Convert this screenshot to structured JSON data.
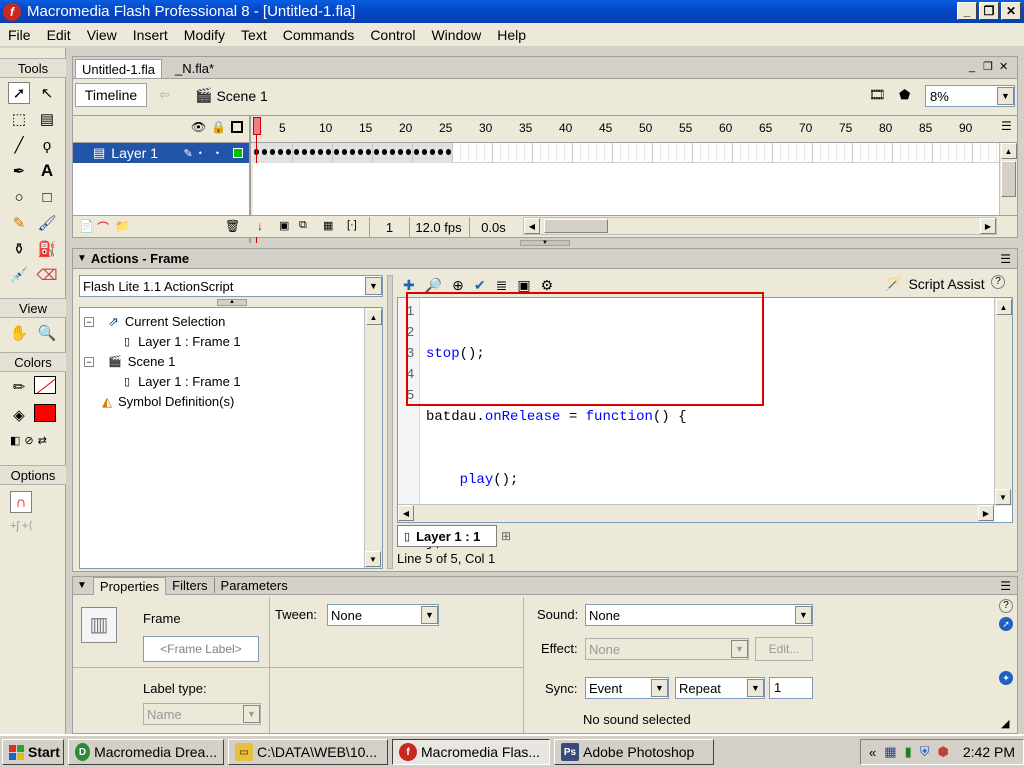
{
  "window": {
    "title": "Macromedia Flash Professional 8 - [Untitled-1.fla]",
    "app_icon": "flash-icon"
  },
  "menu": [
    "File",
    "Edit",
    "View",
    "Insert",
    "Modify",
    "Text",
    "Commands",
    "Control",
    "Window",
    "Help"
  ],
  "tools": {
    "title": "Tools",
    "view_label": "View",
    "colors_label": "Colors",
    "options_label": "Options",
    "stroke_color": "#000000",
    "fill_color": "#ff0000"
  },
  "documents": {
    "tabs": [
      "Untitled-1.fla",
      "_N.fla*"
    ],
    "timeline_button": "Timeline",
    "scene": "Scene 1",
    "zoom": "8%"
  },
  "timeline": {
    "frame_numbers": [
      "1",
      "5",
      "10",
      "15",
      "20",
      "25",
      "30",
      "35",
      "40",
      "45",
      "50",
      "55",
      "60",
      "65",
      "70",
      "75",
      "80",
      "85",
      "90"
    ],
    "layer_name": "Layer 1",
    "current_frame": "1",
    "fps": "12.0 fps",
    "time": "0.0s"
  },
  "actions": {
    "title": "Actions - Frame",
    "language": "Flash Lite 1.1 ActionScript",
    "script_assist": "Script Assist",
    "tree": [
      {
        "label": "Current Selection",
        "level": 0
      },
      {
        "label": "Layer 1 : Frame 1",
        "level": 1
      },
      {
        "label": "Scene 1",
        "level": 0
      },
      {
        "label": "Layer 1 : Frame 1",
        "level": 1
      },
      {
        "label": "Symbol Definition(s)",
        "level": 0
      }
    ],
    "line_numbers": [
      "1",
      "2",
      "3",
      "4",
      "5"
    ],
    "code": {
      "l1_kw": "stop",
      "l1_rest": "();",
      "l2_obj": "batdau.",
      "l2_kw": "onRelease",
      "l2_op": " = ",
      "l2_fn": "function",
      "l2_rest": "() {",
      "l3_kw": "play",
      "l3_rest": "();",
      "l4": "};"
    },
    "script_tab": "Layer 1 : 1",
    "status": "Line 5 of 5, Col 1"
  },
  "properties": {
    "tabs": [
      "Properties",
      "Filters",
      "Parameters"
    ],
    "frame_label": "Frame",
    "frame_placeholder": "<Frame Label>",
    "label_type_label": "Label type:",
    "label_type_value": "Name",
    "tween_label": "Tween:",
    "tween_value": "None",
    "sound_label": "Sound:",
    "sound_value": "None",
    "effect_label": "Effect:",
    "effect_value": "None",
    "edit_button": "Edit...",
    "sync_label": "Sync:",
    "sync_value": "Event",
    "repeat_value": "Repeat",
    "repeat_count": "1",
    "no_sound": "No sound selected"
  },
  "taskbar": {
    "start": "Start",
    "tasks": [
      {
        "label": "Macromedia Drea...",
        "icon": "dreamweaver-icon",
        "active": false
      },
      {
        "label": "C:\\DATA\\WEB\\10...",
        "icon": "folder-icon",
        "active": false
      },
      {
        "label": "Macromedia Flas...",
        "icon": "flash-icon",
        "active": true
      },
      {
        "label": "Adobe Photoshop",
        "icon": "photoshop-icon",
        "active": false
      }
    ],
    "clock": "2:42 PM"
  }
}
